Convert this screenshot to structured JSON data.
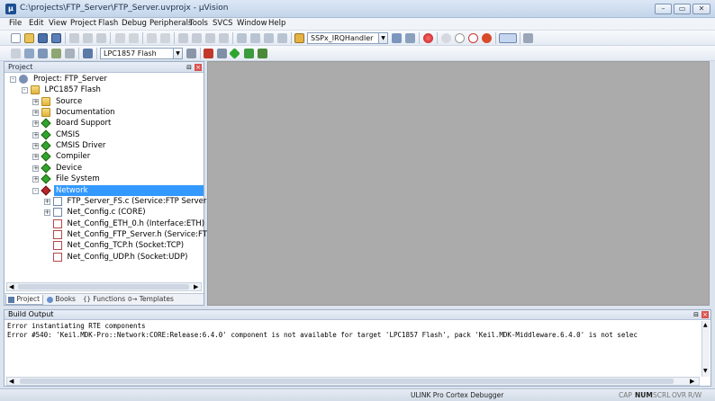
{
  "window": {
    "title": "C:\\projects\\FTP_Server\\FTP_Server.uvprojx - µVision",
    "app_icon": "keil-uvision-icon",
    "controls": [
      "minimize",
      "maximize",
      "close"
    ]
  },
  "menubar": {
    "items": [
      "File",
      "Edit",
      "View",
      "Project",
      "Flash",
      "Debug",
      "Peripherals",
      "Tools",
      "SVCS",
      "Window",
      "Help"
    ]
  },
  "toolbar1": {
    "function_combo": "SSPx_IRQHandler"
  },
  "toolbar2": {
    "target_combo": "LPC1857 Flash"
  },
  "project_panel": {
    "title": "Project",
    "tree": [
      {
        "label": "Project: FTP_Server",
        "level": 0,
        "expander": "-",
        "icon": "project-icon"
      },
      {
        "label": "LPC1857 Flash",
        "level": 1,
        "expander": "-",
        "icon": "target-folder-icon"
      },
      {
        "label": "Source",
        "level": 2,
        "expander": "+",
        "icon": "folder-icon"
      },
      {
        "label": "Documentation",
        "level": 2,
        "expander": "+",
        "icon": "folder-icon"
      },
      {
        "label": "Board Support",
        "level": 2,
        "expander": "+",
        "icon": "component-icon"
      },
      {
        "label": "CMSIS",
        "level": 2,
        "expander": "+",
        "icon": "component-icon"
      },
      {
        "label": "CMSIS Driver",
        "level": 2,
        "expander": "+",
        "icon": "component-icon"
      },
      {
        "label": "Compiler",
        "level": 2,
        "expander": "+",
        "icon": "component-icon"
      },
      {
        "label": "Device",
        "level": 2,
        "expander": "+",
        "icon": "component-icon"
      },
      {
        "label": "File System",
        "level": 2,
        "expander": "+",
        "icon": "component-icon"
      },
      {
        "label": "Network",
        "level": 2,
        "expander": "-",
        "icon": "component-error-icon",
        "selected": true
      },
      {
        "label": "FTP_Server_FS.c (Service:FTP Server)",
        "level": 3,
        "expander": "+",
        "icon": "c-file-icon"
      },
      {
        "label": "Net_Config.c (CORE)",
        "level": 3,
        "expander": "+",
        "icon": "c-file-icon"
      },
      {
        "label": "Net_Config_ETH_0.h (Interface:ETH)",
        "level": 3,
        "expander": "",
        "icon": "h-file-icon"
      },
      {
        "label": "Net_Config_FTP_Server.h (Service:FTP Server)",
        "level": 3,
        "expander": "",
        "icon": "h-file-icon"
      },
      {
        "label": "Net_Config_TCP.h (Socket:TCP)",
        "level": 3,
        "expander": "",
        "icon": "h-file-icon"
      },
      {
        "label": "Net_Config_UDP.h (Socket:UDP)",
        "level": 3,
        "expander": "",
        "icon": "h-file-icon"
      }
    ],
    "tabs": [
      {
        "label": "Project",
        "icon": "project-tab-icon",
        "active": true
      },
      {
        "label": "Books",
        "icon": "books-icon"
      },
      {
        "label": "Functions",
        "icon": "functions-icon"
      },
      {
        "label": "Templates",
        "icon": "templates-icon"
      }
    ]
  },
  "build_output": {
    "title": "Build Output",
    "lines": [
      "Error instantiating RTE components",
      "Error #540: 'Keil.MDK-Pro::Network:CORE:Release:6.4.0' component is not available for target 'LPC1857 Flash', pack 'Keil.MDK-Middleware.6.4.0' is not selec"
    ]
  },
  "statusbar": {
    "debugger": "ULINK Pro Cortex Debugger",
    "indicators": [
      "CAP",
      "NUM",
      "SCRL",
      "OVR",
      "R/W"
    ],
    "active_indicator": "NUM"
  },
  "colors": {
    "selection": "#3399ff",
    "editor_bg": "#ababab",
    "component_icon": "#2fa52f",
    "component_error_icon": "#b8262a"
  }
}
